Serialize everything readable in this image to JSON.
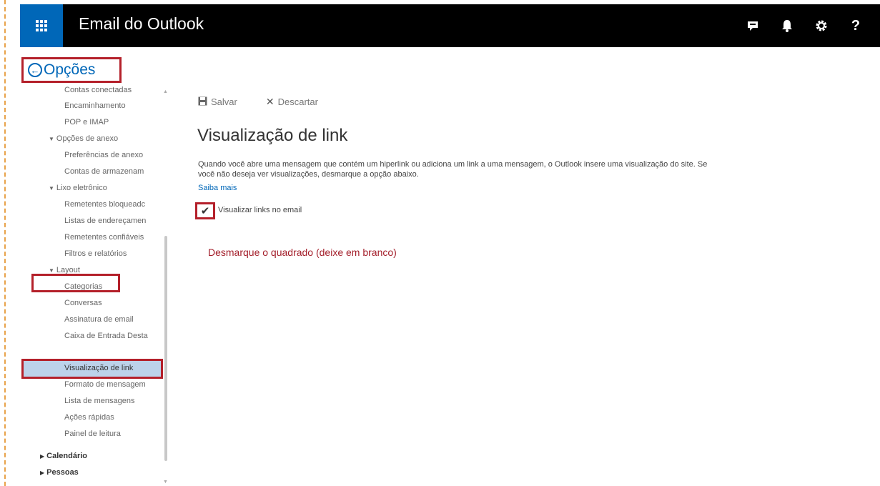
{
  "app": {
    "title": "Email do Outlook",
    "accent_color": "#0067b8",
    "highlight_color": "#b4202a"
  },
  "topbar": {
    "icons": [
      "chat-icon",
      "bell-icon",
      "gear-icon",
      "help-icon"
    ],
    "help_glyph": "?"
  },
  "sidebar": {
    "back_icon": "back-arrow-icon",
    "title": "Opções",
    "items": [
      {
        "label": "Contas conectadas"
      },
      {
        "label": "Encaminhamento"
      },
      {
        "label": "POP e IMAP"
      },
      {
        "label": "Opções de anexo"
      },
      {
        "label": "Preferências de anexo"
      },
      {
        "label": "Contas de armazenam"
      },
      {
        "label": "Lixo eletrônico"
      },
      {
        "label": "Remetentes bloqueadc"
      },
      {
        "label": "Listas de endereçamen"
      },
      {
        "label": "Remetentes confiáveis"
      },
      {
        "label": "Filtros e relatórios"
      },
      {
        "label": "Layout"
      },
      {
        "label": "Categorias"
      },
      {
        "label": "Conversas"
      },
      {
        "label": "Assinatura de email"
      },
      {
        "label": "Caixa de Entrada Desta"
      },
      {
        "label": "Visualização de link"
      },
      {
        "label": "Formato de mensagem"
      },
      {
        "label": "Lista de mensagens"
      },
      {
        "label": "Ações rápidas"
      },
      {
        "label": "Painel de leitura"
      },
      {
        "label": "Calendário"
      },
      {
        "label": "Pessoas"
      }
    ],
    "selected_item": "Visualização de link"
  },
  "toolbar": {
    "save_label": "Salvar",
    "discard_label": "Descartar"
  },
  "main": {
    "title": "Visualização de link",
    "description": "Quando você abre uma mensagem que contém um hiperlink ou adiciona um link a uma mensagem, o Outlook insere uma visualização do site. Se você não deseja ver visualizações, desmarque a opção abaixo.",
    "learn_more": "Saiba mais",
    "checkbox_label": "Visualizar links no email",
    "checkbox_checked": true,
    "annotation": "Desmarque o quadrado (deixe em branco)"
  }
}
